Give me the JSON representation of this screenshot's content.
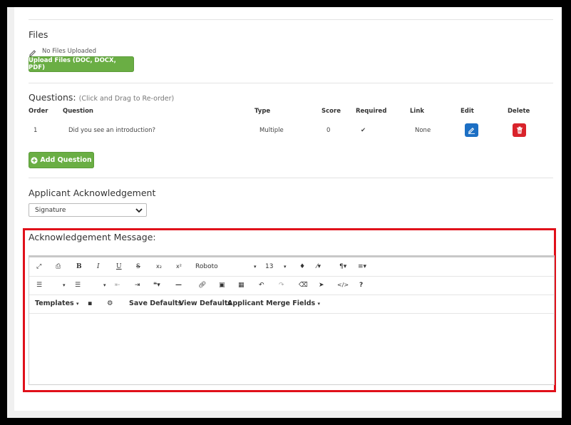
{
  "files": {
    "title": "Files",
    "status": "No Files Uploaded",
    "upload_label": "Upload Files (DOC, DOCX, PDF)"
  },
  "questions": {
    "title": "Questions:",
    "hint": "(Click and Drag to Re-order)",
    "headers": {
      "order": "Order",
      "question": "Question",
      "type": "Type",
      "score": "Score",
      "required": "Required",
      "link": "Link",
      "edit": "Edit",
      "delete": "Delete"
    },
    "rows": [
      {
        "order": "1",
        "question": "Did you see an introduction?",
        "type": "Multiple",
        "score": "0",
        "required": "✔",
        "link": "None"
      }
    ],
    "add_label": "Add Question"
  },
  "acknowledgement": {
    "title": "Applicant Acknowledgement",
    "select_value": "Signature",
    "message_label": "Acknowledgement Message:"
  },
  "editor": {
    "font_name": "Roboto",
    "font_size": "13",
    "menu": {
      "templates": "Templates",
      "save_defaults": "Save Defaults",
      "view_defaults": "View Defaults",
      "merge_fields": "Applicant Merge Fields"
    },
    "content": ""
  },
  "colors": {
    "green": "#6aae44",
    "edit_blue": "#1c6fc4",
    "delete_red": "#d9232b",
    "highlight_red": "#e0101a"
  }
}
